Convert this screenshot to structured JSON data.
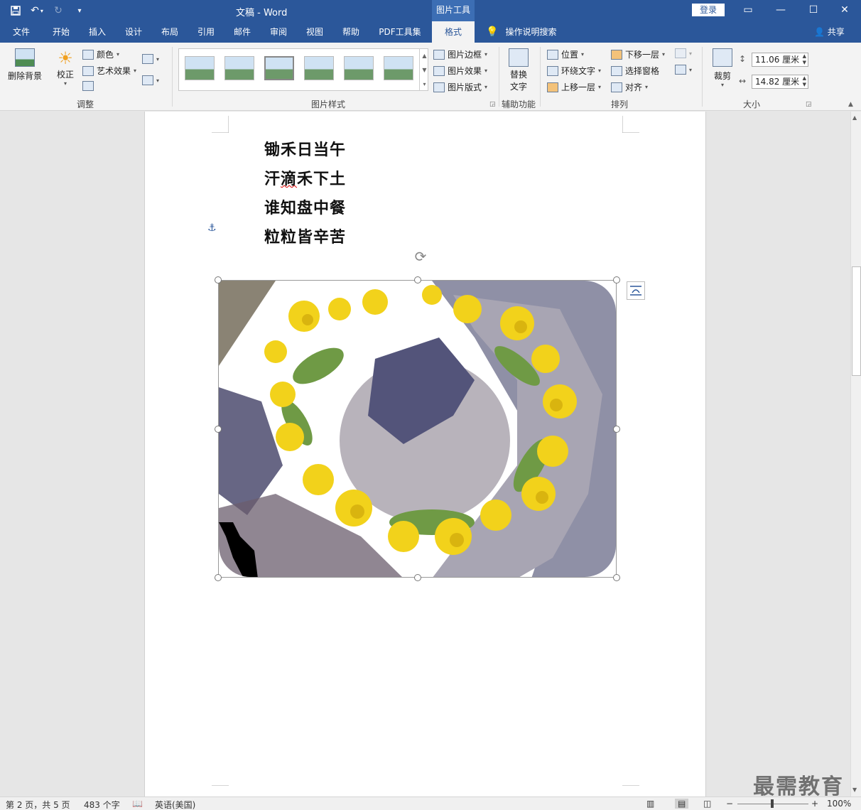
{
  "titlebar": {
    "doc_title": "文稿 - Word",
    "context_tab": "图片工具",
    "login": "登录"
  },
  "tabs": [
    {
      "label": "文件"
    },
    {
      "label": "开始"
    },
    {
      "label": "插入"
    },
    {
      "label": "设计"
    },
    {
      "label": "布局"
    },
    {
      "label": "引用"
    },
    {
      "label": "邮件"
    },
    {
      "label": "审阅"
    },
    {
      "label": "视图"
    },
    {
      "label": "帮助"
    },
    {
      "label": "PDF工具集"
    },
    {
      "label": "格式",
      "active": true
    }
  ],
  "tellme": "操作说明搜索",
  "share": "共享",
  "ribbon": {
    "adjust": {
      "remove_bg": "删除背景",
      "corrections": "校正",
      "color": "颜色",
      "artistic": "艺术效果",
      "group_label": "调整"
    },
    "styles": {
      "border": "图片边框",
      "effects": "图片效果",
      "layout": "图片版式",
      "group_label": "图片样式"
    },
    "accessibility": {
      "alt_text_line1": "替换",
      "alt_text_line2": "文字",
      "group_label": "辅助功能"
    },
    "arrange": {
      "position": "位置",
      "wrap_text": "环绕文字",
      "bring_forward": "上移一层",
      "send_backward": "下移一层",
      "selection_pane": "选择窗格",
      "align": "对齐",
      "group_label": "排列"
    },
    "size": {
      "crop": "裁剪",
      "height": "11.06 厘米",
      "width": "14.82 厘米",
      "group_label": "大小"
    }
  },
  "document": {
    "poem": [
      {
        "text": "锄禾日当午"
      },
      {
        "text_pre": "汗",
        "text_squiggle": "滴",
        "text_post": "禾下土"
      },
      {
        "text": "谁知盘中餐"
      },
      {
        "text": "粒粒皆辛苦"
      }
    ]
  },
  "statusbar": {
    "page": "第 2 页，共 5 页",
    "words": "483 个字",
    "language": "英语(美国)",
    "zoom": "100%"
  },
  "watermark": "最需教育",
  "colors": {
    "brand": "#2b579a",
    "ribbon_bg": "#f3f3f3",
    "doc_bg": "#e6e6e6"
  }
}
